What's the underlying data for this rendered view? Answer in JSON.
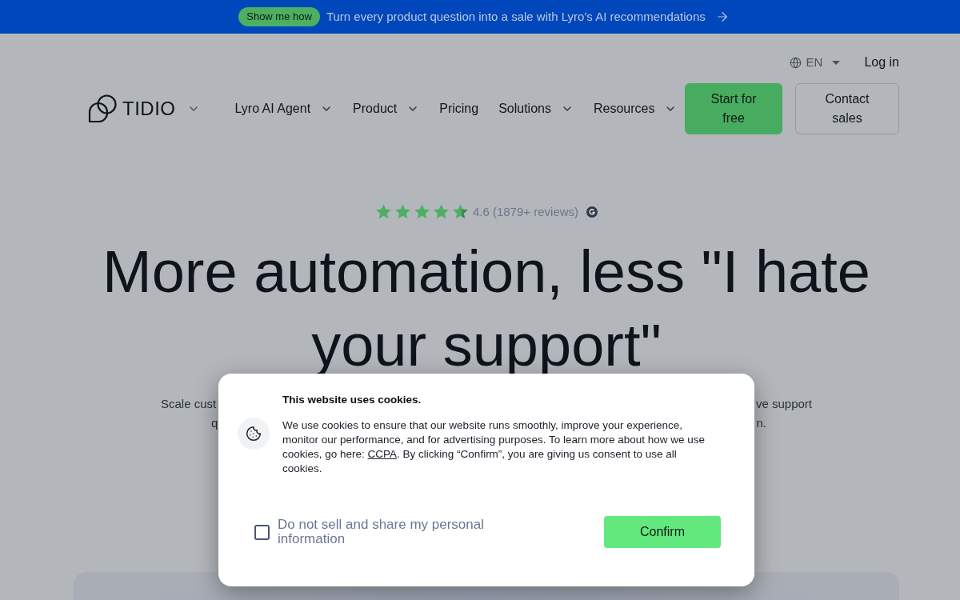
{
  "promo_banner": {
    "button": "Show me how",
    "message": "Turn every product question into a sale with Lyro’s AI recommendations"
  },
  "utility_bar": {
    "language": "EN",
    "login": "Log in"
  },
  "nav": {
    "logo": "TIDIO",
    "items": [
      {
        "label": "Lyro AI Agent",
        "dropdown": true
      },
      {
        "label": "Product",
        "dropdown": true
      },
      {
        "label": "Pricing",
        "dropdown": false
      },
      {
        "label": "Solutions",
        "dropdown": true
      },
      {
        "label": "Resources",
        "dropdown": true
      }
    ],
    "primary_button": "Start for free",
    "secondary_button": "Contact sales"
  },
  "rating": {
    "stars": 4.6,
    "text": "4.6 (1879+ reviews)"
  },
  "hero": {
    "headline": "More automation, less \"I hate your support\"",
    "subtitle_visible_parts": [
      {
        "left": "Scale cust",
        "right": "ve support"
      },
      {
        "left": "q",
        "right": "n."
      }
    ]
  },
  "cookie_dialog": {
    "title": "This website uses cookies.",
    "body_before_link": "We use cookies to ensure that our website runs smoothly, improve your experience, monitor our performance, and for advertising purposes. To learn more about how we use cookies, go here: ",
    "link": "CCPA",
    "body_after_link": ". By clicking “Confirm”, you are giving us consent to use all cookies.",
    "opt_out": {
      "label": "Do not sell and share my personal information",
      "checked": false
    },
    "confirm_button": "Confirm"
  }
}
